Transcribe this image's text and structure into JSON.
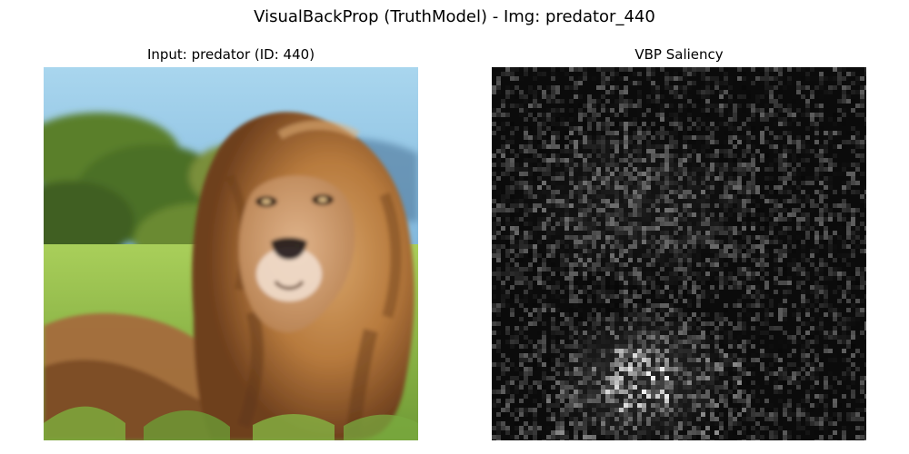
{
  "figure": {
    "title": "VisualBackProp (TruthModel) - Img: predator_440"
  },
  "panels": [
    {
      "title": "Input: predator (ID: 440)",
      "content": "input-image"
    },
    {
      "title": "VBP Saliency",
      "content": "saliency-map",
      "colormap": "gray"
    }
  ],
  "colors": {
    "sky": "#8ec7e6",
    "distant_hills": "#5c86a8",
    "trees": "#4f7a2c",
    "grass": "#a8cc58",
    "mane_dark": "#7b4a22",
    "mane_light": "#d49a5a",
    "face": "#c8956a",
    "saliency_bg": "#0b0b0b"
  }
}
